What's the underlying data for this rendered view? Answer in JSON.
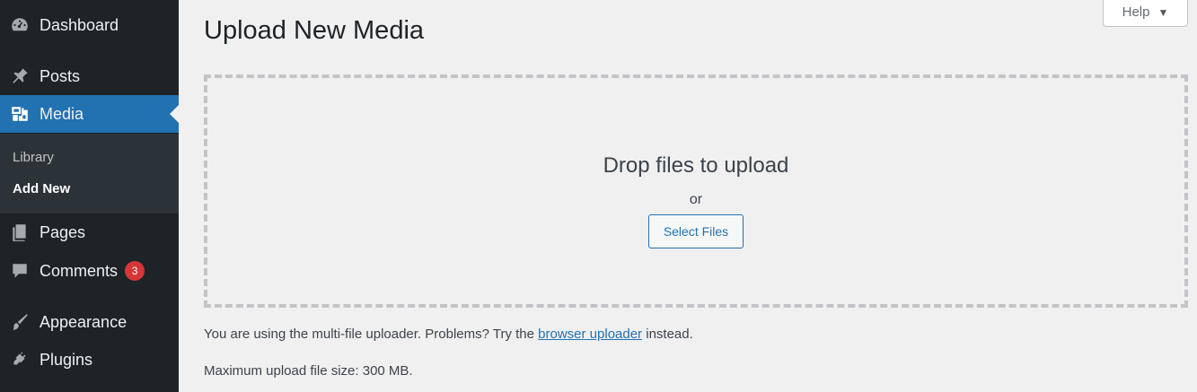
{
  "sidebar": {
    "items": [
      {
        "label": "Dashboard",
        "icon": "dashboard-icon"
      },
      {
        "label": "Posts",
        "icon": "pin-icon"
      },
      {
        "label": "Media",
        "icon": "media-icon"
      },
      {
        "label": "Pages",
        "icon": "pages-icon"
      },
      {
        "label": "Comments",
        "icon": "comment-icon",
        "badge": "3"
      },
      {
        "label": "Appearance",
        "icon": "brush-icon"
      },
      {
        "label": "Plugins",
        "icon": "plug-icon"
      }
    ],
    "submenu": [
      {
        "label": "Library"
      },
      {
        "label": "Add New"
      }
    ]
  },
  "header": {
    "title": "Upload New Media",
    "help_label": "Help"
  },
  "uploader": {
    "drop_text": "Drop files to upload",
    "or_text": "or",
    "select_label": "Select Files",
    "info_prefix": "You are using the multi-file uploader. Problems? Try the",
    "info_link": "browser uploader",
    "info_suffix": "instead.",
    "max_size": "Maximum upload file size: 300 MB."
  },
  "colors": {
    "sidebar_bg": "#1d2327",
    "active_bg": "#2271b1",
    "badge_bg": "#d63638",
    "page_bg": "#f0f0f1"
  }
}
